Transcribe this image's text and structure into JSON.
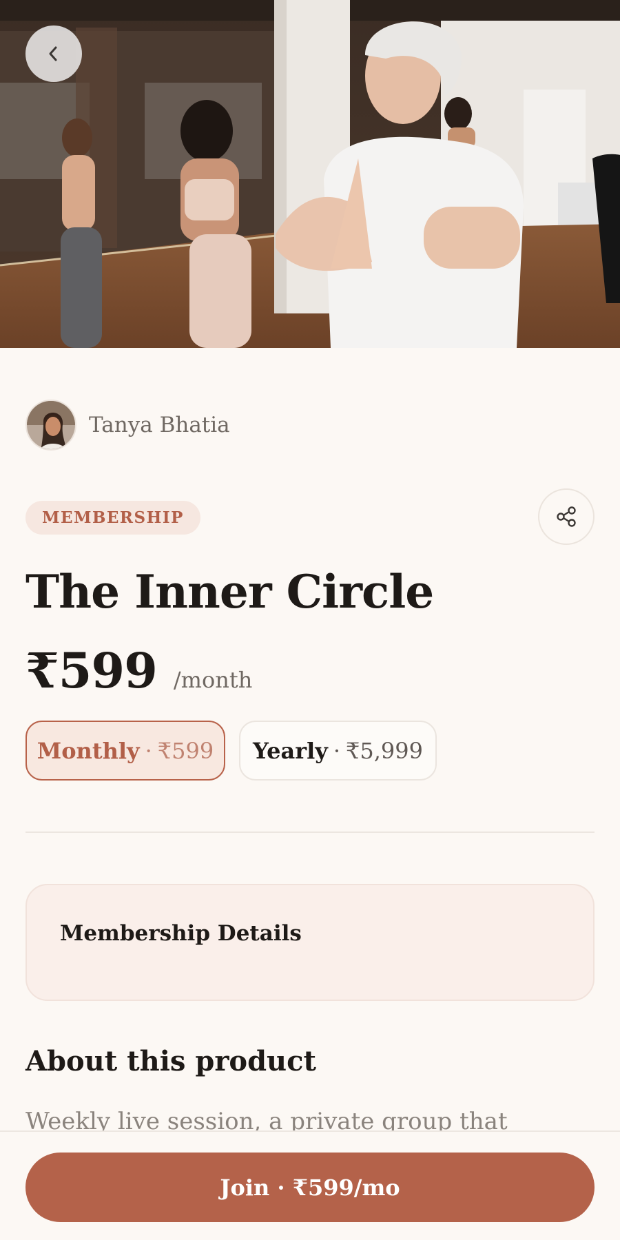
{
  "hero": {
    "image_icon": "yoga-class-photo"
  },
  "nav": {
    "back_icon": "chevron-left-icon"
  },
  "author": {
    "name": "Tanya Bhatia"
  },
  "product": {
    "badge": "MEMBERSHIP",
    "title": "The Inner Circle",
    "price": "₹599",
    "period": "/month"
  },
  "plans": [
    {
      "label": "Monthly",
      "separator": "·",
      "amount": "₹599",
      "selected": true
    },
    {
      "label": "Yearly",
      "separator": "·",
      "amount": "₹5,999",
      "selected": false
    }
  ],
  "share": {
    "icon": "share-icon"
  },
  "details": {
    "title": "Membership Details"
  },
  "about": {
    "title": "About this product",
    "text": "Weekly live session, a private group that"
  },
  "cta": {
    "label": "Join · ₹599/mo"
  },
  "colors": {
    "accent": "#b4624a",
    "accent_soft": "#f8e8e0",
    "background": "#fcf8f4",
    "text": "#1e1a17",
    "muted": "#6f6862"
  }
}
